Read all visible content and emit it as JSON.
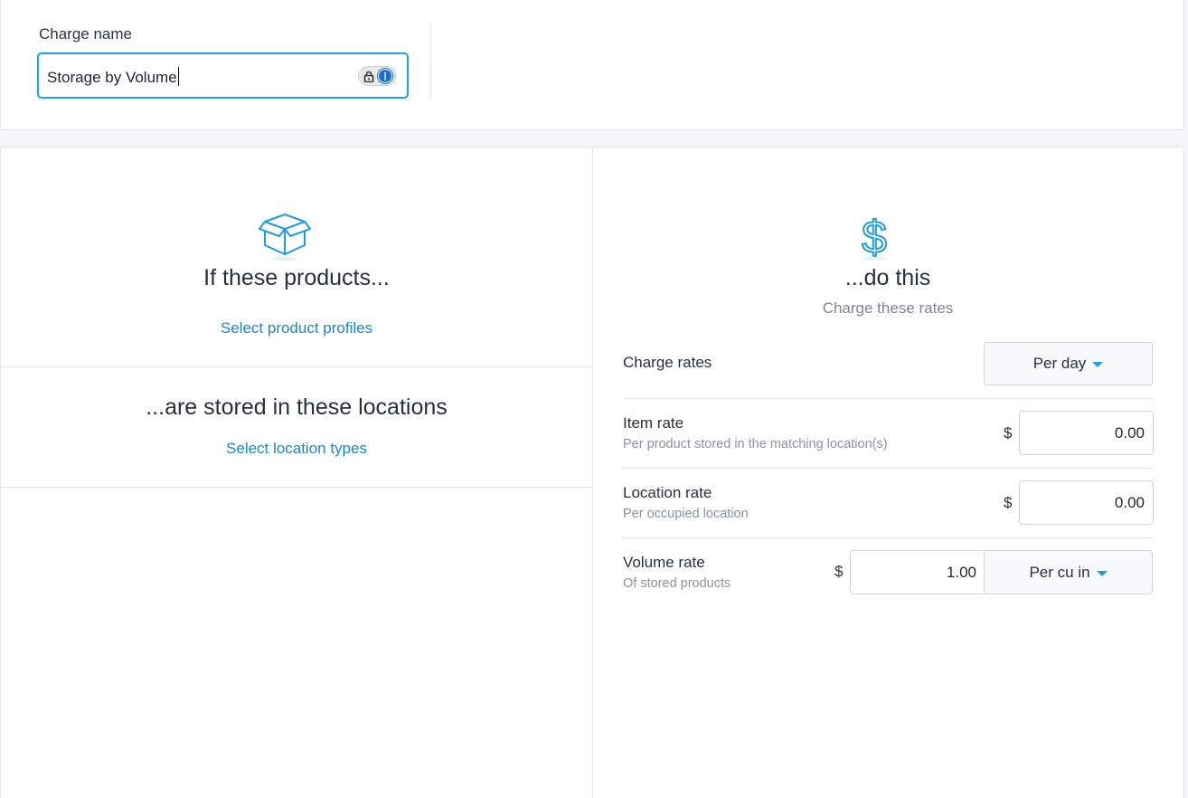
{
  "charge_name": {
    "label": "Charge name",
    "value": "Storage by Volume"
  },
  "left": {
    "products_heading": "If these products...",
    "products_link": "Select product profiles",
    "locations_heading": "...are stored in these locations",
    "locations_link": "Select location types"
  },
  "right": {
    "heading": "...do this",
    "subheading": "Charge these rates",
    "charge_rates": {
      "label": "Charge rates",
      "selected": "Per day"
    },
    "item_rate": {
      "label": "Item rate",
      "hint": "Per product stored in the matching location(s)",
      "currency": "$",
      "value": "0.00"
    },
    "location_rate": {
      "label": "Location rate",
      "hint": "Per occupied location",
      "currency": "$",
      "value": "0.00"
    },
    "volume_rate": {
      "label": "Volume rate",
      "hint": "Of stored products",
      "currency": "$",
      "value": "1.00",
      "unit": "Per cu in"
    }
  },
  "icons": [
    "lock-icon",
    "onepassword-icon",
    "box-icon",
    "dollar-icon",
    "caret-down-icon"
  ],
  "colors": {
    "accent": "#1f9be0",
    "link": "#1b84d1",
    "focus_border": "#23a6e0"
  }
}
